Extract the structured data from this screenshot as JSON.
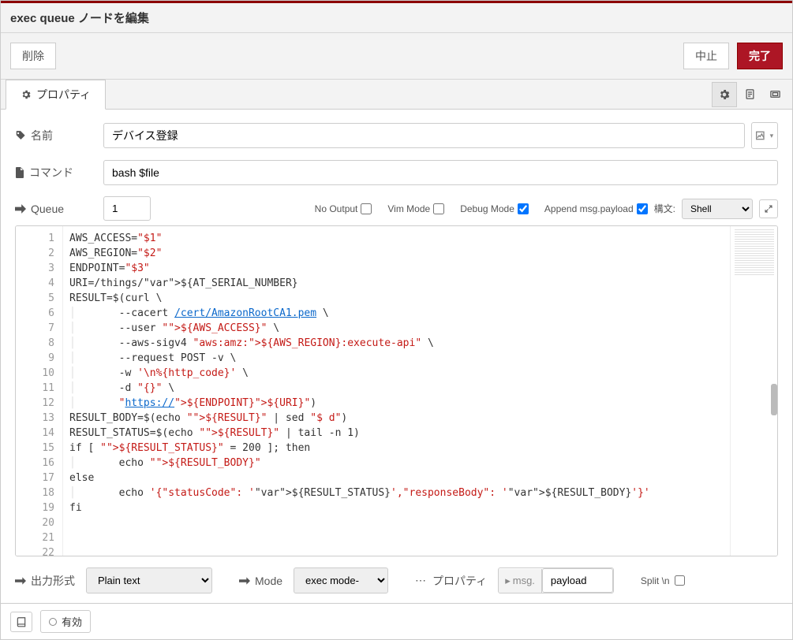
{
  "titlebar": "exec queue ノードを編集",
  "buttons": {
    "delete": "削除",
    "cancel": "中止",
    "done": "完了"
  },
  "tab": {
    "properties": "プロパティ"
  },
  "fields": {
    "name_label": "名前",
    "name_value": "デバイス登録",
    "command_label": "コマンド",
    "command_value": "bash $file",
    "queue_label": "Queue",
    "queue_value": "1"
  },
  "editor_opts": {
    "no_output": "No Output",
    "vim_mode": "Vim Mode",
    "debug_mode": "Debug Mode",
    "append_msg": "Append msg.payload",
    "syntax_label": "構文:",
    "syntax_value": "Shell"
  },
  "checkboxes": {
    "no_output": false,
    "vim_mode": false,
    "debug_mode": true,
    "append_msg": true,
    "split_n": false
  },
  "code_lines": [
    "AWS_ACCESS=\"$1\"",
    "AWS_REGION=\"$2\"",
    "ENDPOINT=\"$3\"",
    "URI=/things/${AT_SERIAL_NUMBER}",
    "",
    "RESULT=$(curl \\",
    "        --cacert /cert/AmazonRootCA1.pem \\",
    "        --user \"${AWS_ACCESS}\" \\",
    "        --aws-sigv4 \"aws:amz:${AWS_REGION}:execute-api\" \\",
    "        --request POST -v \\",
    "        -w '\\n%{http_code}' \\",
    "        -d \"{}\" \\",
    "        \"https://${ENDPOINT}${URI}\")",
    "",
    "RESULT_BODY=$(echo \"${RESULT}\" | sed \"$ d\")",
    "RESULT_STATUS=$(echo \"${RESULT}\" | tail -n 1)",
    "",
    "if [ \"${RESULT_STATUS}\" = 200 ]; then",
    "        echo \"${RESULT_BODY}\"",
    "else",
    "        echo '{\"statusCode\": '${RESULT_STATUS}',\"responseBody\": '${RESULT_BODY}'}'",
    "fi"
  ],
  "bottom": {
    "output_label": "出力形式",
    "output_value": "Plain text",
    "mode_label": "Mode",
    "mode_value": "exec mode-",
    "property_label": "プロパティ",
    "property_prefix": "msg.",
    "property_value": "payload",
    "split_label": "Split \\n"
  },
  "footer": {
    "enabled": "有効"
  }
}
